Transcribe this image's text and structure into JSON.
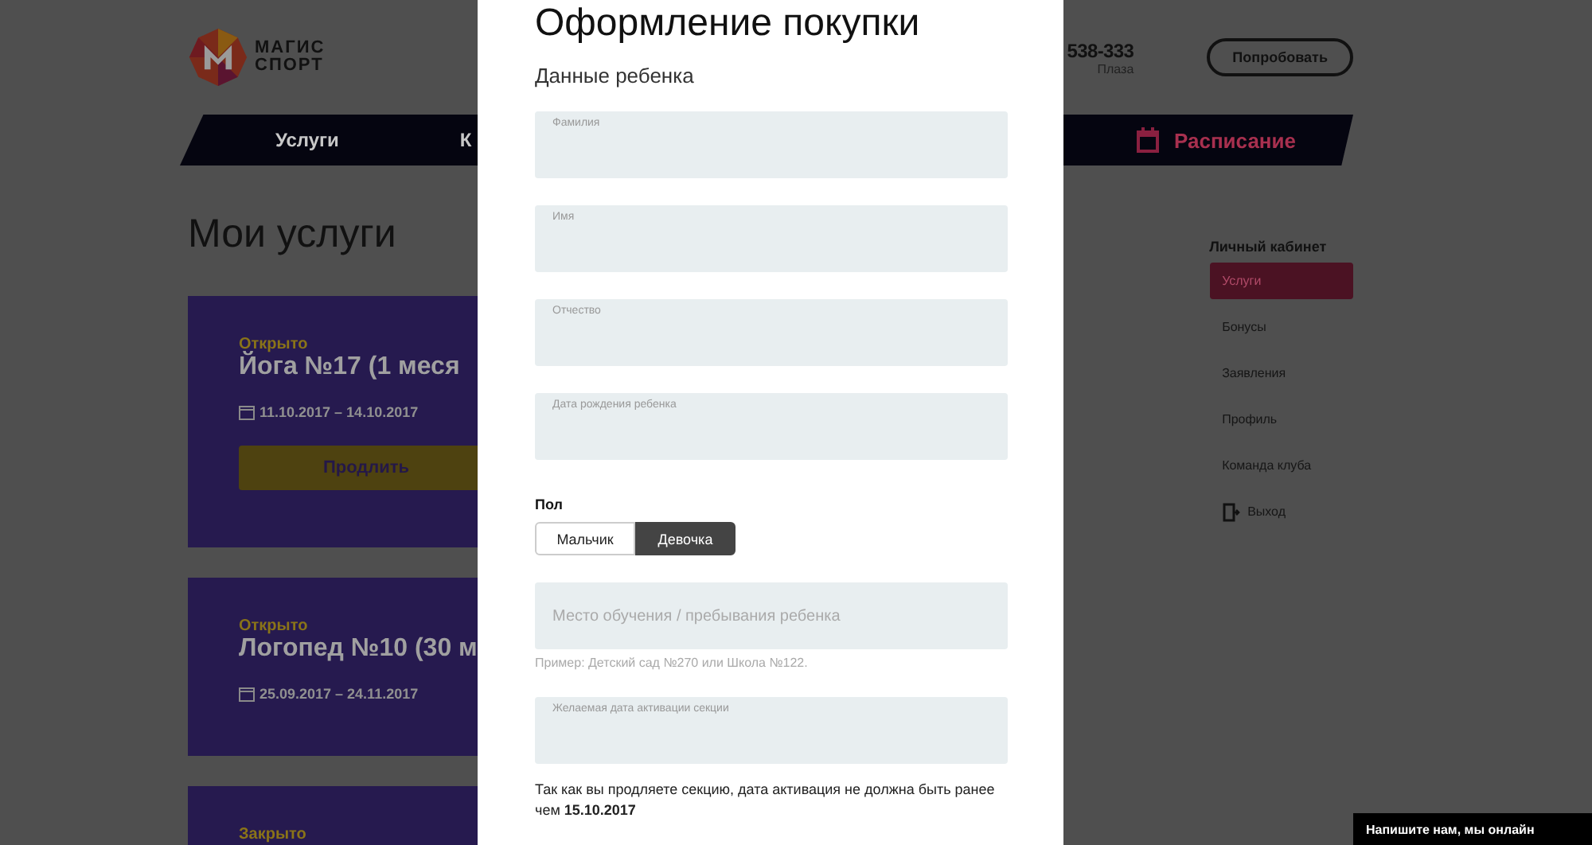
{
  "header": {
    "logo_lines": [
      "МАГИС",
      "СПОРТ"
    ],
    "phone": "538-333",
    "club": "Плаза",
    "try_button": "Попробовать"
  },
  "nav": {
    "items": [
      {
        "label": "Услуги",
        "kind": "text"
      },
      {
        "label": "К",
        "kind": "text"
      },
      {
        "label": "Расписание",
        "kind": "schedule"
      }
    ]
  },
  "page_title": "Мои услуги",
  "services": [
    {
      "status": "Открыто",
      "title": "Йога №17 (1 меся",
      "dates": "11.10.2017 – 14.10.2017",
      "button": "Продлить"
    },
    {
      "status": "Открыто",
      "title": "Логопед №10 (30 м",
      "dates": "25.09.2017 – 24.11.2017"
    },
    {
      "status": "Закрыто"
    }
  ],
  "sidebar": {
    "title": "Личный кабинет",
    "items": [
      {
        "label": "Услуги",
        "selected": true,
        "kind": "link"
      },
      {
        "label": "Бонусы",
        "selected": false,
        "kind": "link"
      },
      {
        "label": "Заявления",
        "selected": false,
        "kind": "link"
      },
      {
        "label": "Профиль",
        "selected": false,
        "kind": "link"
      },
      {
        "label": "Команда клуба",
        "selected": false,
        "kind": "link"
      },
      {
        "label": "Выход",
        "selected": false,
        "kind": "exit"
      }
    ]
  },
  "modal": {
    "title": "Оформление покупки",
    "subtitle": "Данные ребенка",
    "fields": [
      {
        "label": "Фамилия"
      },
      {
        "label": "Имя"
      },
      {
        "label": "Отчество"
      },
      {
        "label": "Дата рождения ребенка"
      }
    ],
    "gender": {
      "label": "Пол",
      "options": [
        {
          "label": "Мальчик",
          "selected": false
        },
        {
          "label": "Девочка",
          "selected": true
        }
      ]
    },
    "place_field": {
      "placeholder": "Место обучения / пребывания ребенка",
      "hint": "Пример: Детский сад №270 или Школа №122."
    },
    "activation_field": {
      "label": "Желаемая дата активации секции"
    },
    "note": "Так как вы продляете секцию, дата активация не должна быть ранее чем **15.10.2017**"
  },
  "chat": {
    "label": "Напишите нам, мы онлайн"
  }
}
